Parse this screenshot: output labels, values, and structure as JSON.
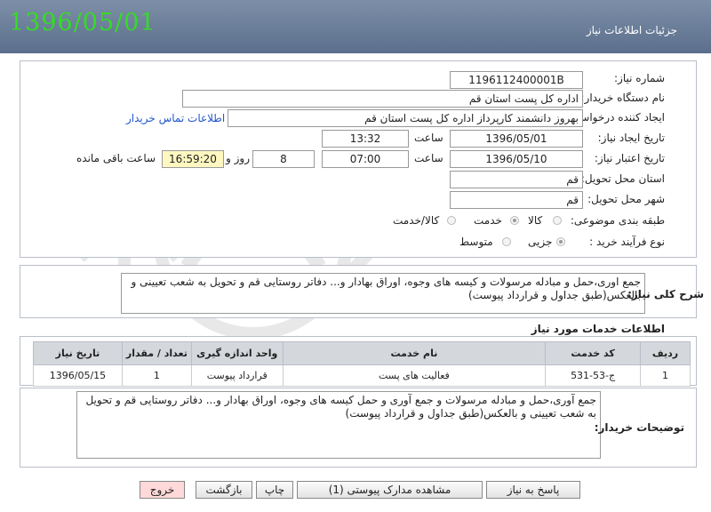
{
  "header": {
    "date": "1396/05/01",
    "title": "جزئیات اطلاعات نیاز"
  },
  "form": {
    "need_number_label": "شماره نیاز:",
    "need_number": "1196112400001B",
    "buyer_org_label": "نام دستگاه خریدار:",
    "buyer_org": "اداره کل پست استان قم",
    "requester_label": "ایجاد کننده درخواست:",
    "requester": "بهروز دانشمند کارپرداز اداره کل پست استان قم",
    "contact_link": "اطلاعات تماس خریدار",
    "announce_date_label": "تاریخ ایجاد نیاز:",
    "announce_date": "1396/05/01",
    "announce_time_label": "ساعت",
    "announce_time": "13:32",
    "deadline_label": "تاریخ اعتبار نیاز:",
    "deadline_date": "1396/05/10",
    "deadline_time_label": "ساعت",
    "deadline_time": "07:00",
    "days_value": "8",
    "days_label": "روز و",
    "remaining_time": "16:59:20",
    "remaining_label": "ساعت باقی مانده",
    "province_label": "استان محل تحویل:",
    "province": "قم",
    "city_label": "شهر محل تحویل:",
    "city": "قم",
    "category_label": "طبقه بندی موضوعی:",
    "category_options": [
      "کالا",
      "خدمت",
      "کالا/خدمت"
    ],
    "category_selected": "خدمت",
    "process_label": "نوع فرآیند خرید :",
    "process_options": [
      "جزیی",
      "متوسط"
    ],
    "process_selected": "جزیی"
  },
  "description": {
    "label": "شرح کلی نیاز:",
    "text": "جمع اوری،حمل و مبادله مرسولات و کیسه های وجوه، اوراق بهادار و... دفاتر روستایی قم و تحویل به شعب تعیینی و بالعکس(طبق جداول و قرارداد پیوست)"
  },
  "services": {
    "title": "اطلاعات خدمات مورد نیاز",
    "columns": [
      "ردیف",
      "کد خدمت",
      "نام خدمت",
      "واحد اندازه گیری",
      "تعداد / مقدار",
      "تاریخ نیاز"
    ],
    "rows": [
      [
        "1",
        "ج-53-531",
        "فعالیت های پست",
        "قرارداد پیوست",
        "1",
        "1396/05/15"
      ]
    ]
  },
  "buyer_notes": {
    "label": "توضیحات خریدار:",
    "text": "جمع آوری،حمل و مبادله مرسولات و جمع آوری و حمل کیسه های وجوه، اوراق بهادار و... دفاتر روستایی قم و تحویل به شعب تعیینی و بالعکس(طبق جداول و قرارداد پیوست)"
  },
  "buttons": {
    "reply": "پاسخ به نیاز",
    "attachments": "مشاهده مدارک پیوستی (1)",
    "print": "چاپ",
    "back": "بازگشت",
    "exit": "خروج"
  }
}
